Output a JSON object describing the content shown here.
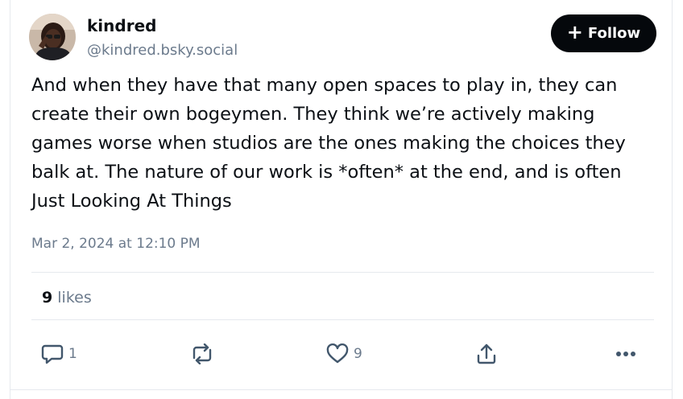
{
  "author": {
    "display_name": "kindred",
    "handle": "@kindred.bsky.social",
    "avatar_icon": "avatar-photo"
  },
  "follow_button": {
    "icon": "plus-icon",
    "plus": "+",
    "label": "Follow"
  },
  "post": {
    "text": "And when they have that many open spaces to play in, they can create their own bogeymen. They think we’re actively making games worse when studios are the ones making the choices they balk at. The nature of our work is *often* at the end, and is often Just Looking At Things",
    "timestamp": "Mar 2, 2024 at 12:10 PM"
  },
  "stats": {
    "likes_count": "9",
    "likes_label": "likes"
  },
  "actions": {
    "reply": {
      "icon": "reply-icon",
      "count": "1"
    },
    "repost": {
      "icon": "repost-icon"
    },
    "like": {
      "icon": "heart-icon",
      "count": "9"
    },
    "share": {
      "icon": "share-icon"
    },
    "more": {
      "icon": "more-icon"
    }
  },
  "colors": {
    "text_primary": "#0b0f14",
    "text_secondary": "#6b7a8c",
    "button_bg": "#05080c",
    "divider": "#e6e9ee",
    "icon": "#42576c"
  }
}
